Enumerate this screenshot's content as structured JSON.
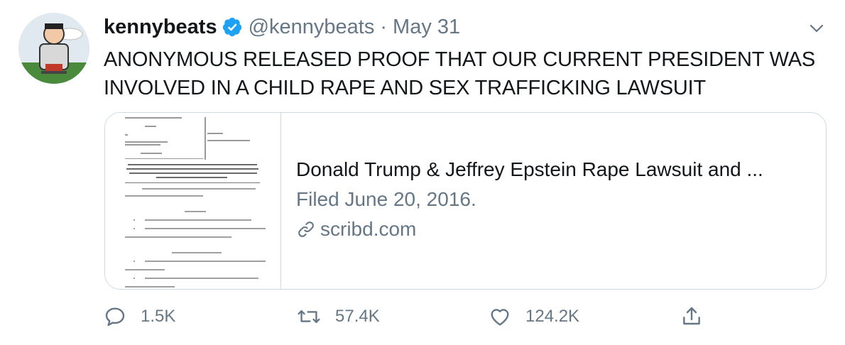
{
  "tweet": {
    "name": "kennybeats",
    "handle": "@kennybeats",
    "separator": "·",
    "date": "May 31",
    "text": "ANONYMOUS RELEASED PROOF THAT OUR CURRENT PRESIDENT WAS INVOLVED IN A CHILD RAPE AND SEX TRAFFICKING LAWSUIT"
  },
  "card": {
    "title": "Donald Trump & Jeffrey Epstein Rape Lawsuit and ...",
    "description": "Filed June 20, 2016.",
    "domain": "scribd.com"
  },
  "actions": {
    "reply_count": "1.5K",
    "retweet_count": "57.4K",
    "like_count": "124.2K"
  },
  "icons": {
    "verified": "verified-badge-icon",
    "caret": "chevron-down-icon",
    "link": "link-icon",
    "reply": "reply-icon",
    "retweet": "retweet-icon",
    "like": "heart-icon",
    "share": "share-icon"
  },
  "colors": {
    "verified": "#1da1f2",
    "secondary_text": "#657786",
    "border": "#cfd9de"
  }
}
